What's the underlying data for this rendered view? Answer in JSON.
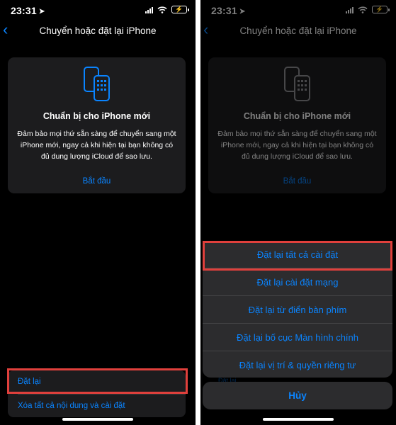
{
  "status_bar": {
    "time": "23:31"
  },
  "left": {
    "nav_title": "Chuyển hoặc đặt lại iPhone",
    "card": {
      "title": "Chuẩn bị cho iPhone mới",
      "description": "Đảm bảo mọi thứ sẵn sàng để chuyển sang một iPhone mới, ngay cả khi hiện tại bạn không có đủ dung lượng iCloud để sao lưu.",
      "start_link": "Bắt đầu"
    },
    "list": [
      "Đặt lại",
      "Xóa tất cả nội dung và cài đặt"
    ]
  },
  "right": {
    "nav_title": "Chuyển hoặc đặt lại iPhone",
    "card": {
      "title": "Chuẩn bị cho iPhone mới",
      "description": "Đảm bảo mọi thứ sẵn sàng để chuyển sang một iPhone mới, ngay cả khi hiện tại bạn không có đủ dung lượng iCloud để sao lưu.",
      "start_link": "Bắt đầu"
    },
    "action_sheet": {
      "options": [
        "Đặt lại tất cả cài đặt",
        "Đặt lại cài đặt mạng",
        "Đặt lại từ điển bàn phím",
        "Đặt lại bố cục Màn hình chính",
        "Đặt lại vị trí & quyền riêng tư"
      ],
      "cancel": "Hủy"
    },
    "peek_text": "Đặt lại"
  },
  "colors": {
    "accent": "#0a84ff",
    "highlight": "#e0403c",
    "card_bg": "#1c1c1e",
    "sheet_bg": "#2c2c2e"
  },
  "icons": [
    "location-arrow-icon",
    "signal-icon",
    "wifi-icon",
    "battery-charging-icon",
    "back-chevron-icon",
    "two-iphones-icon"
  ]
}
